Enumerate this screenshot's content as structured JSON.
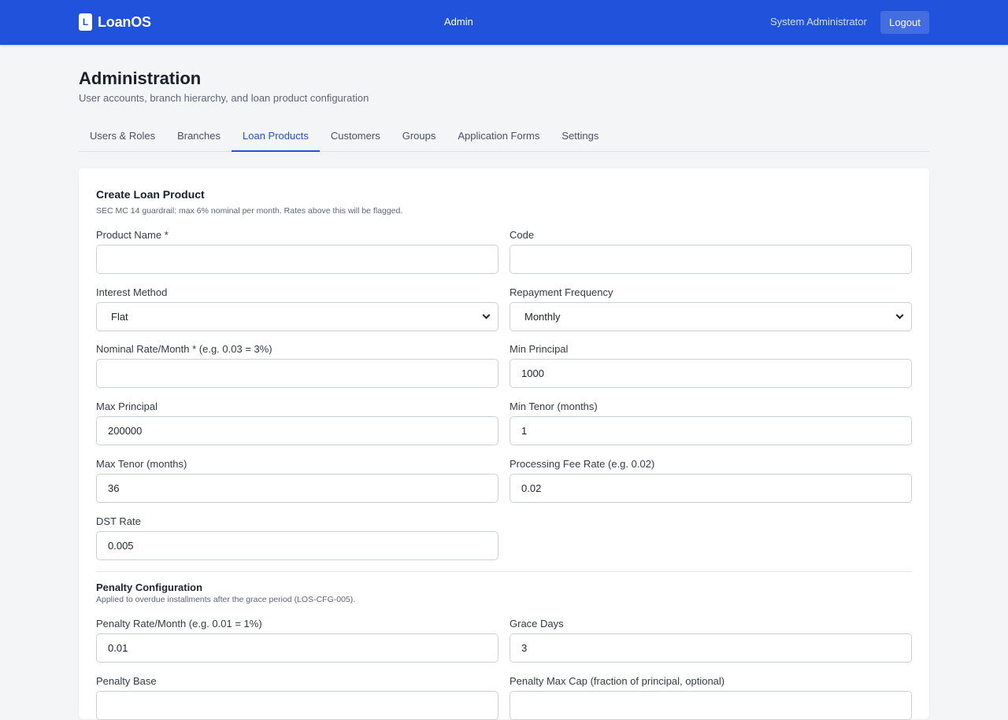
{
  "header": {
    "logo_letter": "L",
    "brand": "LoanOS",
    "nav": "Admin",
    "user": "System Administrator",
    "logout_label": "Logout"
  },
  "page": {
    "title": "Administration",
    "subtitle": "User accounts, branch hierarchy, and loan product configuration"
  },
  "tabs": [
    {
      "label": "Users & Roles",
      "active": false
    },
    {
      "label": "Branches",
      "active": false
    },
    {
      "label": "Loan Products",
      "active": true
    },
    {
      "label": "Customers",
      "active": false
    },
    {
      "label": "Groups",
      "active": false
    },
    {
      "label": "Application Forms",
      "active": false
    },
    {
      "label": "Settings",
      "active": false
    }
  ],
  "form": {
    "title": "Create Loan Product",
    "note": "SEC MC 14 guardrail: max 6% nominal per month. Rates above this will be flagged.",
    "fields": {
      "product_name": {
        "label": "Product Name *",
        "value": ""
      },
      "code": {
        "label": "Code",
        "value": ""
      },
      "interest_method": {
        "label": "Interest Method",
        "value": "Flat"
      },
      "repayment_frequency": {
        "label": "Repayment Frequency",
        "value": "Monthly"
      },
      "nominal_rate": {
        "label": "Nominal Rate/Month * (e.g. 0.03 = 3%)",
        "value": ""
      },
      "min_principal": {
        "label": "Min Principal",
        "value": "1000"
      },
      "max_principal": {
        "label": "Max Principal",
        "value": "200000"
      },
      "min_tenor": {
        "label": "Min Tenor (months)",
        "value": "1"
      },
      "max_tenor": {
        "label": "Max Tenor (months)",
        "value": "36"
      },
      "processing_fee": {
        "label": "Processing Fee Rate (e.g. 0.02)",
        "value": "0.02"
      },
      "dst_rate": {
        "label": "DST Rate",
        "value": "0.005"
      }
    },
    "penalty": {
      "title": "Penalty Configuration",
      "note": "Applied to overdue installments after the grace period (LOS-CFG-005).",
      "fields": {
        "penalty_rate": {
          "label": "Penalty Rate/Month (e.g. 0.01 = 1%)",
          "value": "0.01"
        },
        "grace_days": {
          "label": "Grace Days",
          "value": "3"
        },
        "penalty_base": {
          "label": "Penalty Base",
          "value": ""
        },
        "penalty_max_cap": {
          "label": "Penalty Max Cap (fraction of principal, optional)",
          "value": ""
        }
      }
    }
  }
}
